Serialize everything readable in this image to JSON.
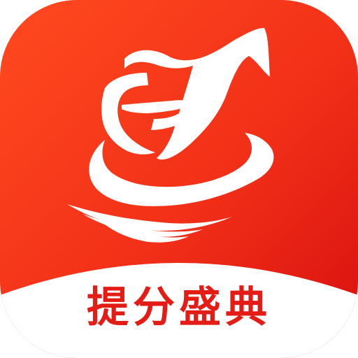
{
  "app_icon": {
    "name": "提分盛典",
    "colors": {
      "gradient_start": "#ff4a1f",
      "gradient_mid": "#f23018",
      "gradient_end": "#d70f0f",
      "symbol": "#ffffff",
      "caption_bg": "#ffffff",
      "caption_text": "#e31c16"
    },
    "icon": "stylized-j-swirl-logo-icon"
  }
}
